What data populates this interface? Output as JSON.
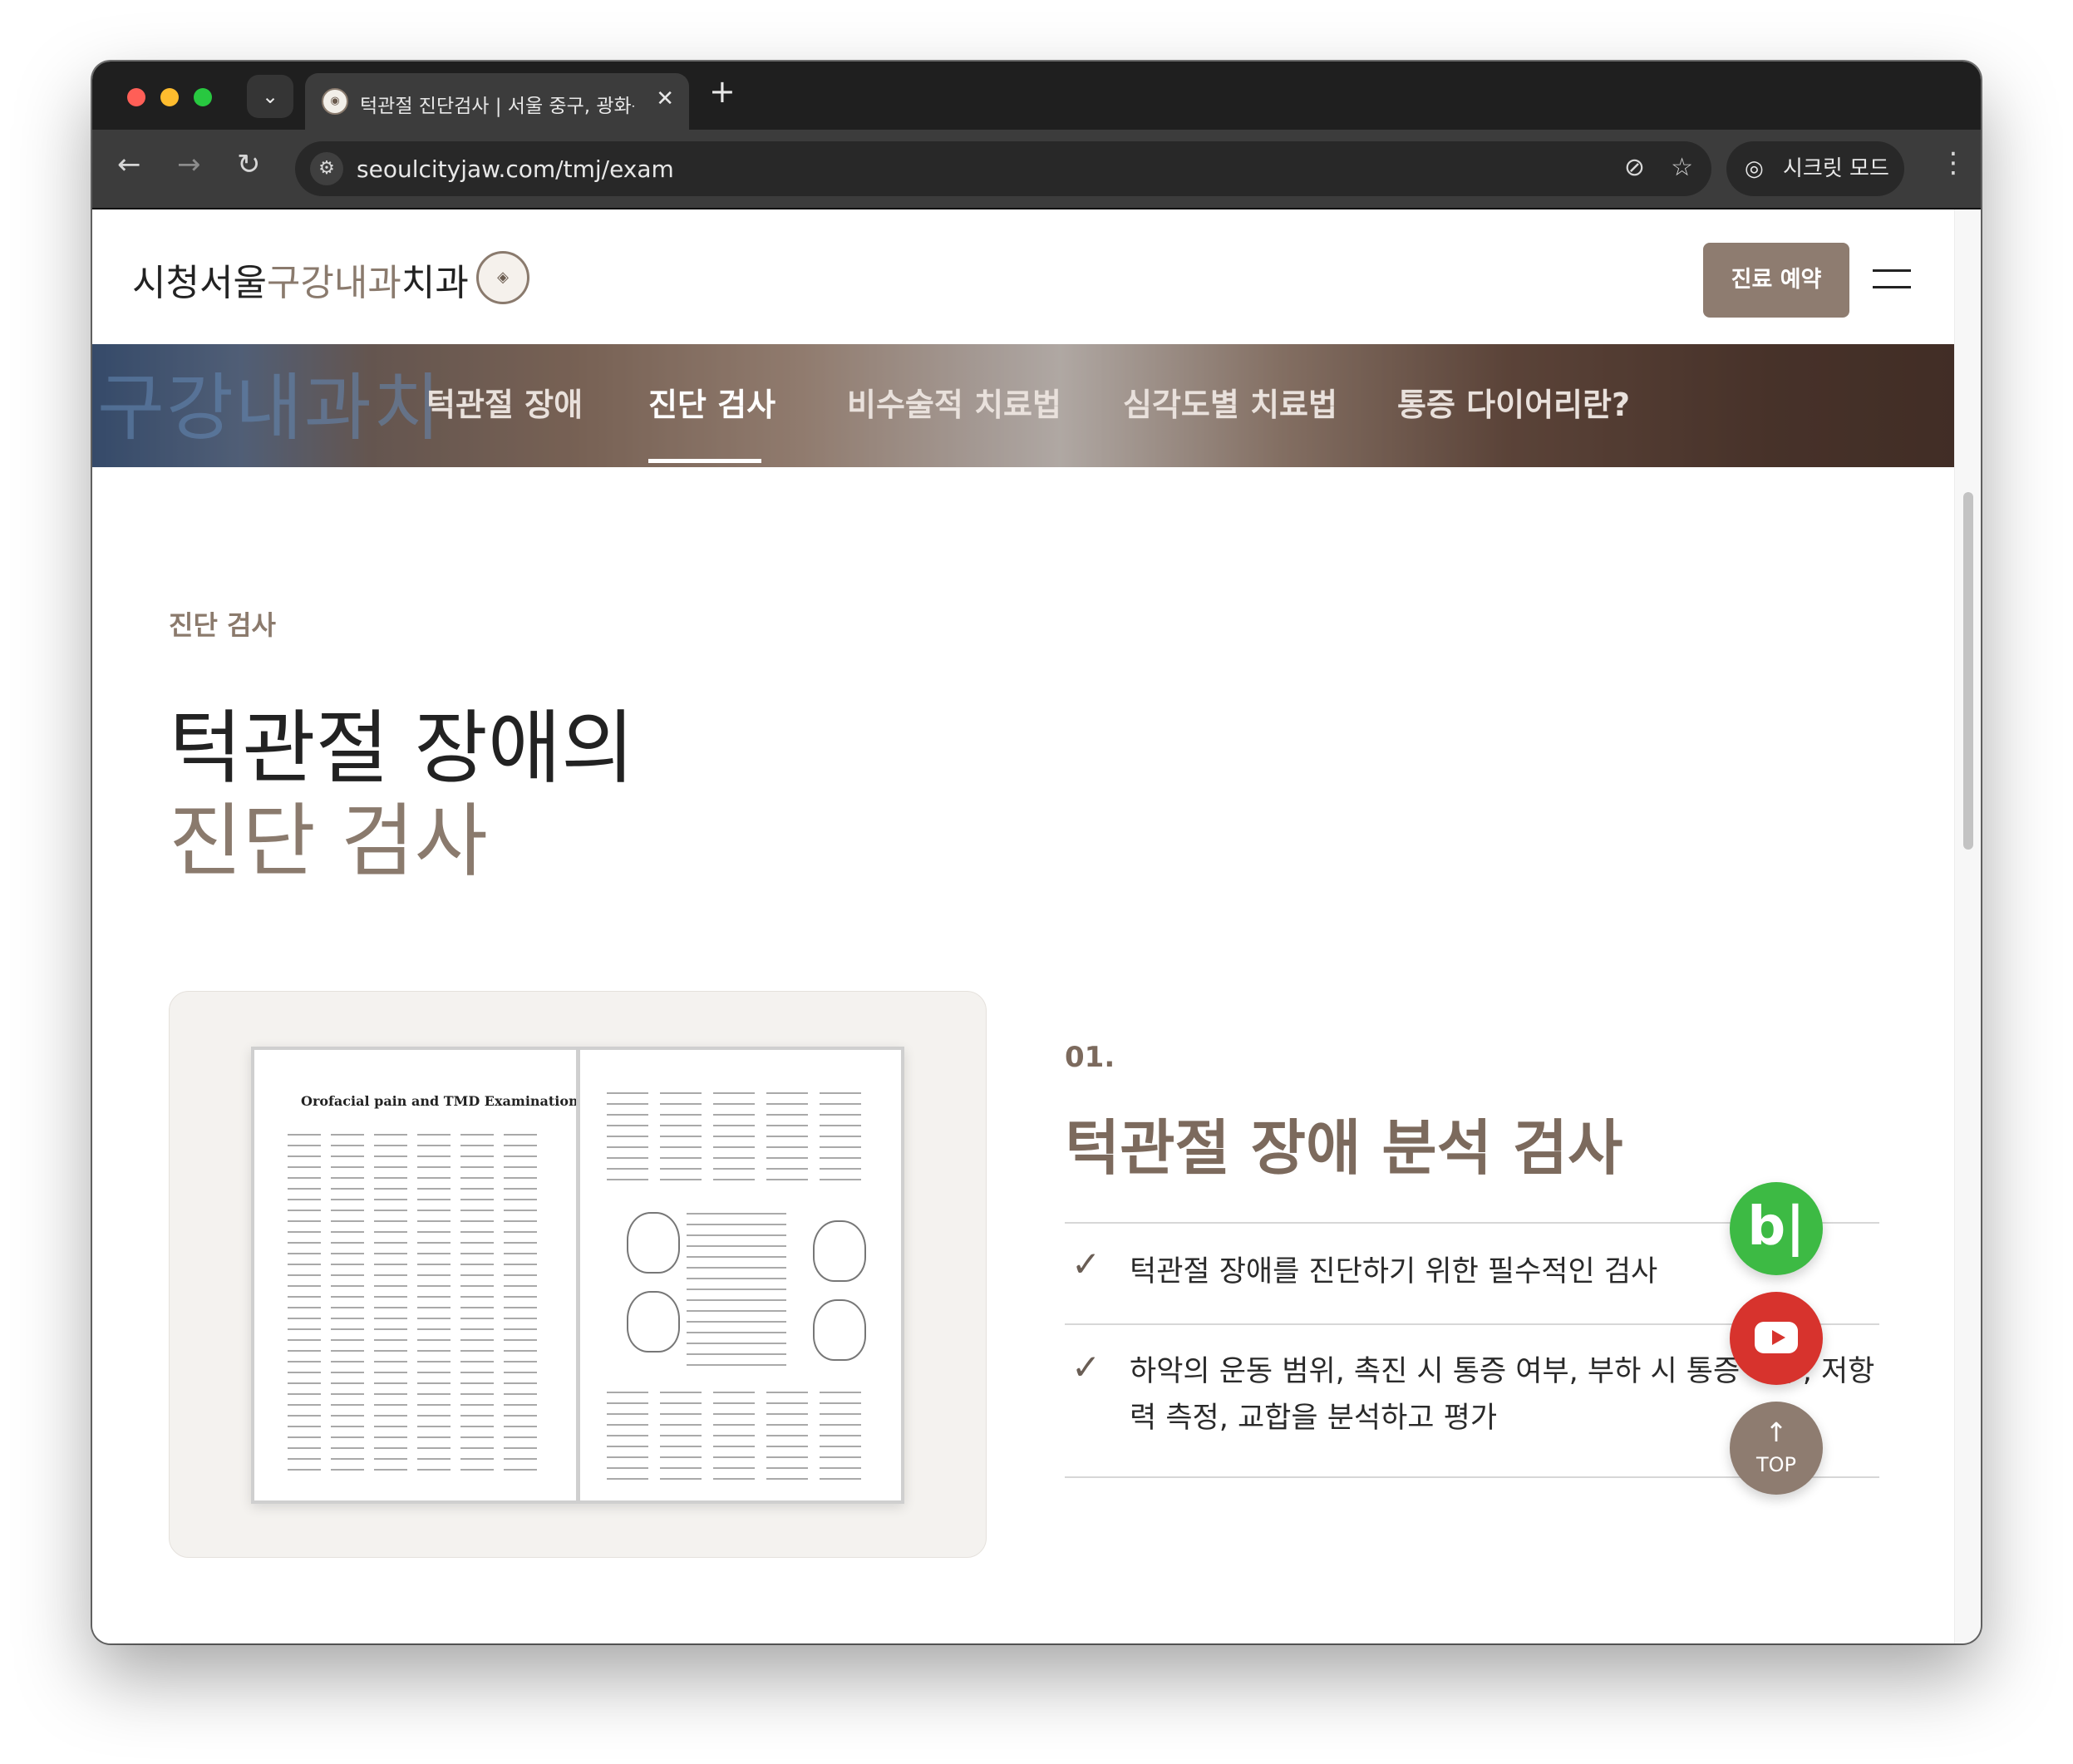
{
  "browser": {
    "tab_title": "턱관절 진단검사 | 서울 중구, 광화문",
    "tab_close": "✕",
    "new_tab": "+",
    "url": "seoulcityjaw.com/tmj/exam",
    "incognito_label": "시크릿 모드",
    "icons": [
      "chevron-down-icon",
      "back-arrow-icon",
      "forward-arrow-icon",
      "reload-icon",
      "site-info-icon",
      "eye-off-icon",
      "star-icon",
      "incognito-icon",
      "kebab-menu-icon"
    ]
  },
  "header": {
    "logo_part1": "시청서울",
    "logo_accent": "구강내과",
    "logo_part2": "치과",
    "reserve_button": "진료 예약"
  },
  "subnav": {
    "banner_text": "구강내과치",
    "items": [
      {
        "label": "턱관절 장애"
      },
      {
        "label": "진단 검사",
        "active": true
      },
      {
        "label": "비수술적 치료법"
      },
      {
        "label": "심각도별 치료법"
      },
      {
        "label": "통증 다이어리란?"
      }
    ]
  },
  "main": {
    "section_label": "진단 검사",
    "headline_line1": "턱관절 장애의",
    "headline_line2": "진단 검사",
    "exam_form_title": "Orofacial pain and TMD Examination",
    "item": {
      "number": "01.",
      "title": "턱관절 장애 분석 검사",
      "bullets": [
        "턱관절 장애를 진단하기 위한 필수적인 검사",
        "하악의 운동 범위, 촉진 시 통증 여부, 부하 시 통증 여부, 저항력 측정, 교합을 분석하고 평가"
      ]
    }
  },
  "floating": {
    "blog_label": "b|",
    "top_arrow": "↑",
    "top_label": "TOP"
  },
  "colors": {
    "brand": "#8e7c70",
    "accent_text": "#8a7a6d",
    "blog_green": "#3dba44",
    "youtube_red": "#d7332d"
  }
}
